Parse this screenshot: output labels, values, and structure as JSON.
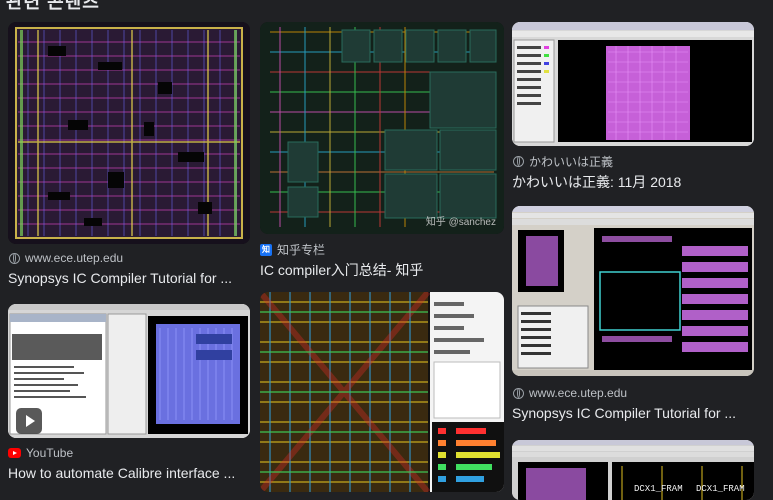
{
  "heading": "관련 콘텐츠",
  "results": [
    {
      "source": "www.ece.utep.edu",
      "title": "Synopsys IC Compiler Tutorial for ...",
      "icon": "globe-icon"
    },
    {
      "source": "知乎专栏",
      "title": "IC compiler入门总结- 知乎",
      "icon": "zhihu-icon",
      "watermark": "知乎 @sanchez"
    },
    {
      "source": "かわいいは正義",
      "title": "かわいいは正義: 11月 2018",
      "icon": "globe-icon"
    },
    {
      "source": "www.ece.utep.edu",
      "title": "Synopsys IC Compiler Tutorial for ...",
      "icon": "globe-icon"
    },
    {
      "source": "YouTube",
      "title": "How to automate Calibre interface ...",
      "icon": "youtube-icon"
    },
    {
      "source": "",
      "title": "",
      "icon": ""
    },
    {
      "source": "",
      "title": "",
      "icon": "",
      "labels": [
        "DCX1_FRAM",
        "DCX1_FRAM"
      ]
    }
  ],
  "colors": {
    "background": "#202124",
    "title": "#e8eaed",
    "source": "#bdc1c6"
  }
}
